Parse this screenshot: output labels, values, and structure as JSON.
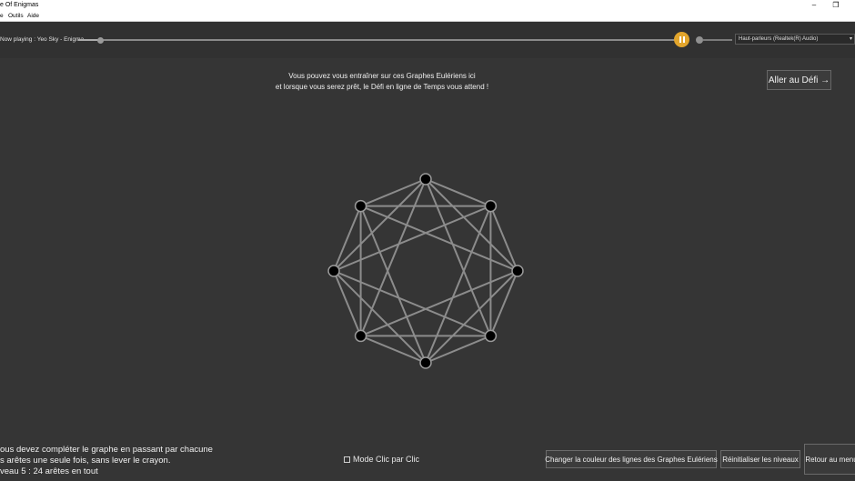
{
  "window": {
    "title": "e Of Enigmas",
    "minimize": "–",
    "restore": "❐"
  },
  "menu": {
    "items": [
      "e",
      "Outils",
      "Aide"
    ]
  },
  "player": {
    "now_playing": "Now playing :  Yeo Sky - Enigma",
    "progress": 0.036,
    "audio_device": "Haut-parleurs (Realtek(R) Audio)"
  },
  "intro": {
    "line1": "Vous pouvez vous entraîner sur ces Graphes Eulériens ici",
    "line2": "et lorsque vous serez prêt, le Défi en ligne de Temps vous attend !"
  },
  "goto_challenge_label": "Aller au Défi →",
  "graph": {
    "node_count": 8,
    "edge_count": 24,
    "edge_color": "#8c8c8c",
    "node_color": "#000000"
  },
  "instructions": {
    "line1": "ous devez compléter le graphe en passant par chacune",
    "line2": "s arêtes une seule fois, sans lever le crayon.",
    "line3": "veau 5 : 24 arêtes en tout"
  },
  "mode_toggle": {
    "label": "Mode Clic par Clic",
    "checked": false
  },
  "buttons": {
    "change_color": "Changer la couleur des lignes des Graphes Eulériens",
    "reset_levels": "Réinitialiser les niveaux",
    "back_menu": "Retour au menu"
  },
  "colors": {
    "accent": "#e2a52c",
    "background": "#353535"
  }
}
